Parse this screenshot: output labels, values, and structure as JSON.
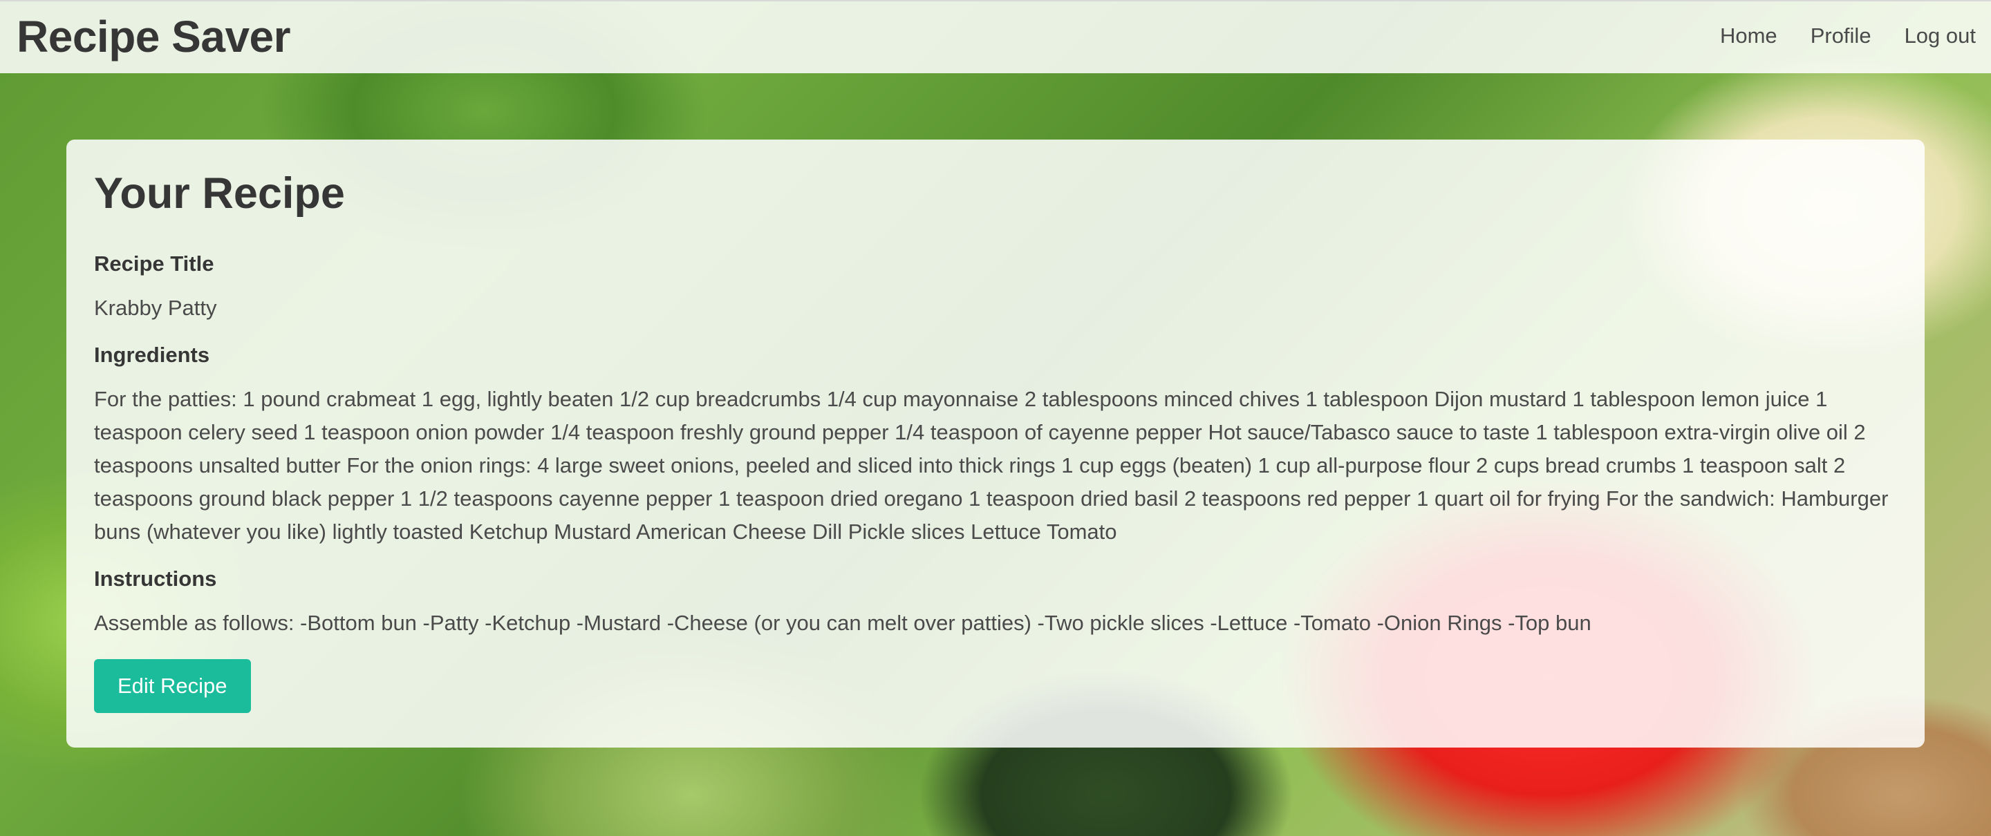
{
  "navbar": {
    "brand": "Recipe Saver",
    "links": [
      "Home",
      "Profile",
      "Log out"
    ]
  },
  "card": {
    "title": "Your Recipe",
    "recipe_title_label": "Recipe Title",
    "recipe_title_value": "Krabby Patty",
    "ingredients_label": "Ingredients",
    "ingredients_value": "For the patties: 1 pound crabmeat 1 egg, lightly beaten 1/2 cup breadcrumbs 1/4 cup mayonnaise 2 tablespoons minced chives 1 tablespoon Dijon mustard 1 tablespoon lemon juice 1 teaspoon celery seed 1 teaspoon onion powder 1/4 teaspoon freshly ground pepper 1/4 teaspoon of cayenne pepper Hot sauce/Tabasco sauce to taste 1 tablespoon extra-virgin olive oil 2 teaspoons unsalted butter For the onion rings: 4 large sweet onions, peeled and sliced into thick rings 1 cup eggs (beaten) 1 cup all-purpose flour 2 cups bread crumbs 1 teaspoon salt 2 teaspoons ground black pepper 1 1/2 teaspoons cayenne pepper 1 teaspoon dried oregano 1 teaspoon dried basil 2 teaspoons red pepper 1 quart oil for frying For the sandwich: Hamburger buns (whatever you like) lightly toasted Ketchup Mustard American Cheese Dill Pickle slices Lettuce Tomato",
    "instructions_label": "Instructions",
    "instructions_value": "Assemble as follows: -Bottom bun -Patty -Ketchup -Mustard -Cheese (or you can melt over patties) -Two pickle slices -Lettuce -Tomato -Onion Rings -Top bun",
    "edit_button": "Edit Recipe"
  },
  "colors": {
    "accent": "#1abc9c",
    "heading": "#363636",
    "text": "#4a4a4a"
  }
}
